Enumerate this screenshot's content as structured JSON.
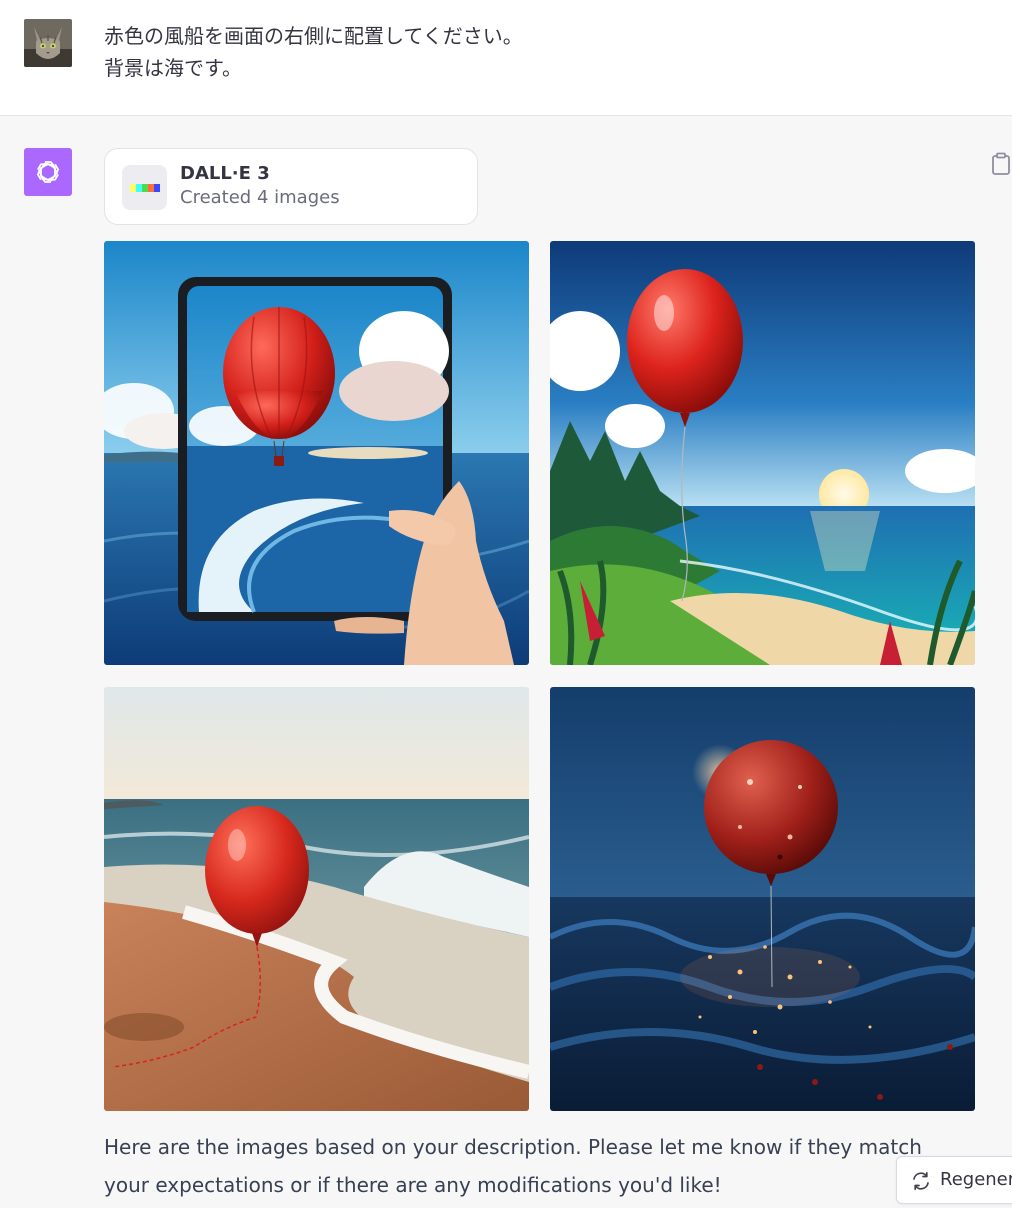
{
  "user_message": {
    "lines": [
      "赤色の風船を画面の右側に配置してください。",
      "背景は海です。"
    ]
  },
  "tool_card": {
    "title": "DALL·E 3",
    "subtitle": "Created 4 images"
  },
  "images": [
    {
      "subject": "tablet-hot-air-balloon"
    },
    {
      "subject": "balloon-coast-sunset"
    },
    {
      "subject": "balloon-beach"
    },
    {
      "subject": "glitter-balloon-night-sea"
    }
  ],
  "assistant_message": {
    "text": "Here are the images based on your description. Please let me know if they match your expectations or if there are any modifications you'd like!"
  },
  "regenerate_button": {
    "label": "Regenera"
  },
  "colors": {
    "assistant_avatar": "#ab68ff",
    "balloon_red": "#d8231e"
  }
}
